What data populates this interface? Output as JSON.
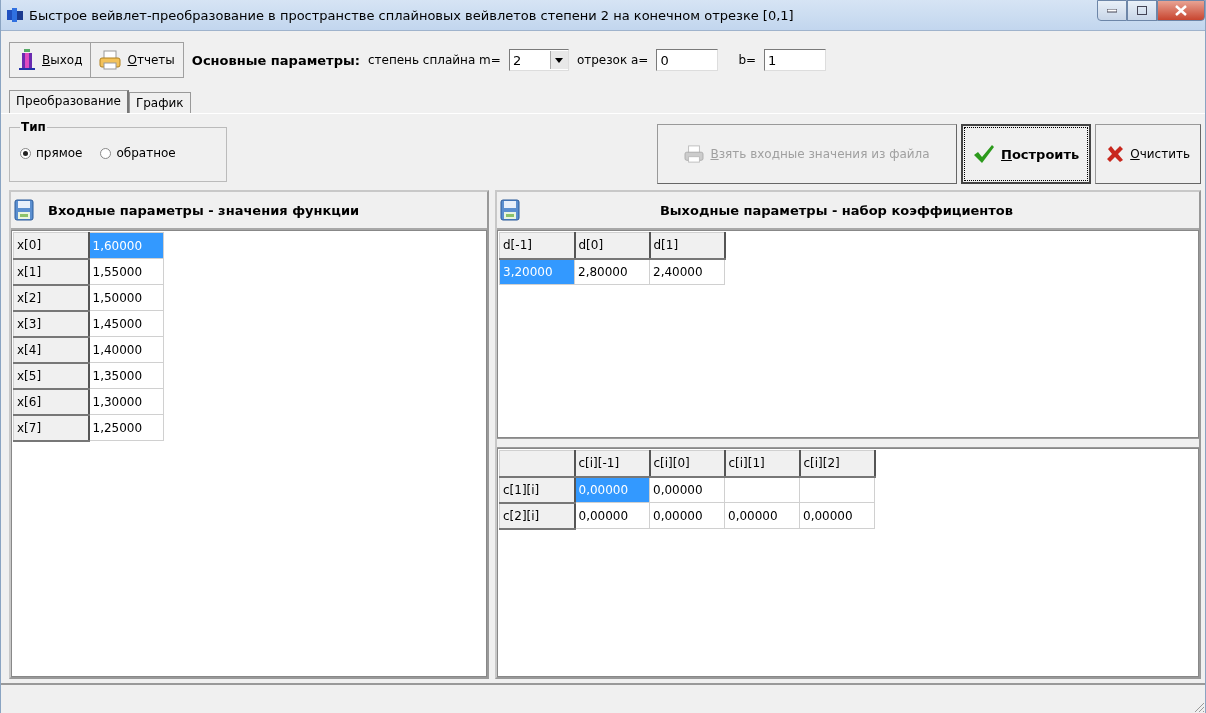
{
  "window": {
    "title": "Быстрое вейвлет-преобразование в пространстве сплайновых вейвлетов степени 2 на конечном отрезке [0,1]"
  },
  "toolbar": {
    "buttons": [
      {
        "label": "Выход",
        "kind": "exit"
      },
      {
        "label": "Отчеты",
        "kind": "reports"
      }
    ],
    "section_label": "Основные параметры:",
    "degree_label": "степень сплайна m=",
    "degree_value": "2",
    "interval_label": "отрезок a=",
    "a_value": "0",
    "b_label": "b=",
    "b_value": "1"
  },
  "tabs": [
    {
      "label": "Преобразование",
      "selected": true
    },
    {
      "label": "График",
      "selected": false
    }
  ],
  "type_group": {
    "title": "Тип",
    "options": [
      {
        "label": "прямое",
        "selected": true
      },
      {
        "label": "обратное",
        "selected": false
      }
    ]
  },
  "actions": [
    {
      "label": "Взять входные значения из файла",
      "kind": "file",
      "disabled": true,
      "focused": false
    },
    {
      "label": "Построить",
      "kind": "build",
      "disabled": false,
      "focused": true
    },
    {
      "label": "Очистить",
      "kind": "clear",
      "disabled": false,
      "focused": false
    }
  ],
  "input_panel": {
    "title": "Входные параметры - значения функции",
    "rows": [
      {
        "label": "x[0]",
        "value": "1,60000",
        "selected": true
      },
      {
        "label": "x[1]",
        "value": "1,55000",
        "selected": false
      },
      {
        "label": "x[2]",
        "value": "1,50000",
        "selected": false
      },
      {
        "label": "x[3]",
        "value": "1,45000",
        "selected": false
      },
      {
        "label": "x[4]",
        "value": "1,40000",
        "selected": false
      },
      {
        "label": "x[5]",
        "value": "1,35000",
        "selected": false
      },
      {
        "label": "x[6]",
        "value": "1,30000",
        "selected": false
      },
      {
        "label": "x[7]",
        "value": "1,25000",
        "selected": false
      }
    ]
  },
  "output_panel": {
    "title": "Выходные параметры - набор коэффициентов",
    "d_table": {
      "columns": [
        "d[-1]",
        "d[0]",
        "d[1]"
      ],
      "rows": [
        [
          {
            "value": "3,20000",
            "selected": true
          },
          {
            "value": "2,80000",
            "selected": false
          },
          {
            "value": "2,40000",
            "selected": false
          }
        ]
      ]
    },
    "c_table": {
      "columns": [
        "c[i][-1]",
        "c[i][0]",
        "c[i][1]",
        "c[i][2]"
      ],
      "rows": [
        {
          "label": "c[1][i]",
          "cells": [
            {
              "value": "0,00000",
              "selected": true
            },
            {
              "value": "0,00000",
              "selected": false
            }
          ]
        },
        {
          "label": "c[2][i]",
          "cells": [
            {
              "value": "0,00000",
              "selected": false
            },
            {
              "value": "0,00000",
              "selected": false
            },
            {
              "value": "0,00000",
              "selected": false
            },
            {
              "value": "0,00000",
              "selected": false
            }
          ]
        }
      ]
    }
  }
}
